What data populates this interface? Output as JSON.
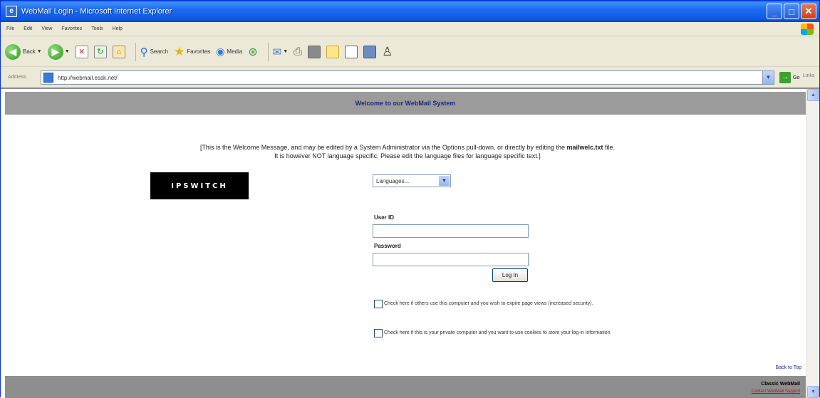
{
  "window": {
    "title": "WebMail Login - Microsoft Internet Explorer"
  },
  "menu": [
    "File",
    "Edit",
    "View",
    "Favorites",
    "Tools",
    "Help"
  ],
  "toolbar": {
    "back_label": "Back",
    "search_label": "Search",
    "favorites_label": "Favorites",
    "media_label": "Media"
  },
  "address": {
    "label": "Address",
    "url": "http://webmail.essk.net/",
    "go_label": "Go",
    "links_label": "Links"
  },
  "page": {
    "header": "Welcome to our WebMail System",
    "welcome_line1_pre": "[This is the Welcome Message, and may be edited by a System Administrator via the Options pull-down, or directly by editing the ",
    "welcome_file": "mailwelc.txt",
    "welcome_line1_post": " file.",
    "welcome_line2": "It is however NOT language specific. Please edit the language files for language specific text.]",
    "logo_text": "IPSWITCH",
    "language_select": "Languages...",
    "user_id_label": "User ID",
    "password_label": "Password",
    "login_button": "Log In",
    "check_expire": "Check here if others use this computer and you wish to expire page views (increased security).",
    "check_cookies": "Check here if this is your private computer and you want to use cookies to store your log-in information.",
    "back_to_top": "Back to Top",
    "classic_webmail": "Classic WebMail",
    "contact": "Contact WebMail Support"
  }
}
